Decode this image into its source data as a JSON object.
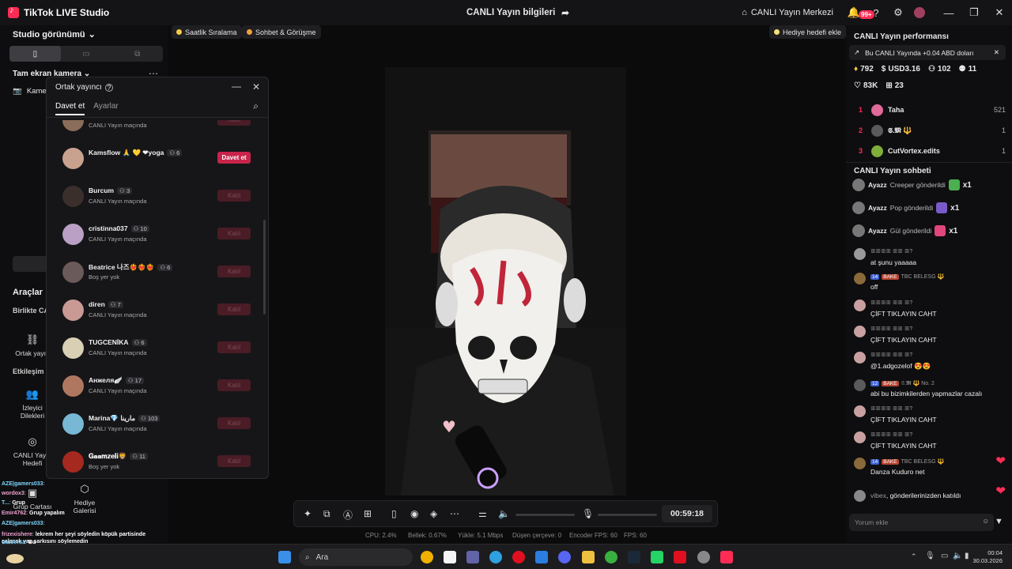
{
  "titlebar": {
    "app_name": "TikTok LIVE Studio",
    "center_title": "CANLI Yayın bilgileri",
    "center_btn": "CANLI Yayın Merkezi",
    "notif_badge": "99+"
  },
  "left": {
    "studio_view": "Studio görünümü",
    "fullscreen_camera": "Tam ekran kamera",
    "camera_label": "Kamera",
    "tools_title": "Araçlar",
    "together_label": "Birlikte CANLI",
    "cohost_label": "Ortak yayın",
    "interaction_label": "Etkileşim",
    "viewer_requests": "İzleyici Dilekleri",
    "live_goal": "CANLI Yayın Hedefi",
    "gift_card": "Grup Cartası",
    "gift_gallery": "Hediye Galerisi",
    "overlay_chat": [
      {
        "user": "AZE|gamers033",
        "text": ""
      },
      {
        "user": "wordox3",
        "text": ""
      },
      {
        "user": "T...",
        "text": "Grup"
      },
      {
        "user": "Emir4762",
        "text": "Grup yapalım"
      },
      {
        "user": "AZE|gamers033",
        "text": ""
      },
      {
        "user": "frizexishere",
        "text": "lekrem her şeyi söyledin köpük partisinde çalacak yaz şarkısını söylemedin"
      },
      {
        "user": "gaz8ersa",
        "text": "Bu"
      },
      {
        "user": "",
        "text": "Çok bulutlu"
      }
    ]
  },
  "pills": {
    "hourly_rank": "Saatlik Sıralama",
    "chat_meet": "Sohbet & Görüşme",
    "gift_goal": "Hediye hedefi ekle"
  },
  "dialog": {
    "title": "Ortak yayıncı",
    "tab_invite": "Davet et",
    "tab_settings": "Ayarlar",
    "rows": [
      {
        "name": "",
        "viewers": "",
        "status": "CANLI Yayın maçında",
        "button": "Katıl",
        "color": "#8a6d5a"
      },
      {
        "name": "Kamsflow 🙏 💛 ❤yoga",
        "viewers": "6",
        "status": "",
        "button": "Davet et",
        "color": "#c9a28f"
      },
      {
        "name": "Burcum",
        "viewers": "3",
        "status": "CANLI Yayın maçında",
        "button": "Katıl",
        "color": "#3b2f2c"
      },
      {
        "name": "cristinna037",
        "viewers": "10",
        "status": "CANLI Yayın maçında",
        "button": "Katıl",
        "color": "#b9a0c4"
      },
      {
        "name": "Beatrice 나즈❤️‍🔥❤️‍🔥❤️‍🔥",
        "viewers": "6",
        "status": "Boş yer yok",
        "button": "Katıl",
        "color": "#6a5a58"
      },
      {
        "name": "diren",
        "viewers": "7",
        "status": "CANLI Yayın maçında",
        "button": "Katıl",
        "color": "#c99a94"
      },
      {
        "name": "TUGCENİKA",
        "viewers": "6",
        "status": "CANLI Yayın maçında",
        "button": "Katıl",
        "color": "#d8cfb4"
      },
      {
        "name": "Анжеля🪽",
        "viewers": "17",
        "status": "CANLI Yayın maçında",
        "button": "Katıl",
        "color": "#b07760"
      },
      {
        "name": "Marina💎 مارينا",
        "viewers": "103",
        "status": "CANLI Yayın maçında",
        "button": "Katıl",
        "color": "#78b8d4"
      },
      {
        "name": "𝐆𝐚𝐚𝐦𝐳𝐞𝐥𝐢🦁",
        "viewers": "11",
        "status": "Boş yer yok",
        "button": "Katıl",
        "color": "#a5291f"
      }
    ]
  },
  "controls": {
    "timer": "00:59:18"
  },
  "stats": {
    "cpu": "CPU:  2.4%",
    "memory": "Bellek:  0.67%",
    "upload": "Yükle:  5.1 Mbps",
    "dropped": "Düşen çerçeve:  0",
    "encoder_fps": "Encoder FPS:  60",
    "fps": "FPS:  60"
  },
  "right": {
    "perf_title": "CANLI Yayın performansı",
    "banner": "Bu CANLI Yayında +0.04 ABD doları",
    "metrics": {
      "diamonds": "792",
      "usd": "USD3.16",
      "followers": "102",
      "new": "11",
      "likes": "83K",
      "gifts": "23"
    },
    "ranking": [
      {
        "n": "1",
        "name": "Taha",
        "value": "521",
        "color": "#e06a9a"
      },
      {
        "n": "2",
        "name": "𝕾.𝕸 🔱",
        "value": "1",
        "color": "#5a5a5a"
      },
      {
        "n": "3",
        "name": "CutVortex.edits",
        "value": "1",
        "color": "#7fae3a"
      }
    ],
    "chat_title": "CANLI Yayın sohbeti",
    "gifts": [
      {
        "user": "Ayazz",
        "gift": "Creeper gönderildi",
        "count": "x1",
        "color": "#4caf50"
      },
      {
        "user": "Ayazz",
        "gift": "Pop gönderildi",
        "count": "x1",
        "color": "#7a5ac8"
      },
      {
        "user": "Ayazz",
        "gift": "Gül gönderildi",
        "count": "x1",
        "color": "#e0457b"
      }
    ],
    "messages": [
      {
        "user": "ꕥꕥꕥꕥ ꕥꕥ ꕥ?",
        "level": "",
        "fan": "",
        "text": "at şunu yaaaaa",
        "color": "#999"
      },
      {
        "user": "TBC BELESG 🔱",
        "level": "14",
        "fan": "BAKE",
        "text": "off",
        "color": "#8a6a3a"
      },
      {
        "user": "ꕥꕥꕥꕥ ꕥꕥ ꕥ?",
        "level": "",
        "fan": "",
        "text": "ÇİFT TIKLAYIN CAHT",
        "color": "#c9a0a0"
      },
      {
        "user": "ꕥꕥꕥꕥ ꕥꕥ ꕥ?",
        "level": "",
        "fan": "",
        "text": "ÇİFT TIKLAYIN CAHT",
        "color": "#c9a0a0"
      },
      {
        "user": "ꕥꕥꕥꕥ ꕥꕥ ꕥ?",
        "level": "",
        "fan": "",
        "text": "@1.adgozelof 😍😍",
        "color": "#c9a0a0"
      },
      {
        "user": "𝕾.𝕸 🔱  No. 2",
        "level": "12",
        "fan": "BAKE",
        "text": "abi bu bizimkilerden yapmazlar cazalı",
        "color": "#5a5a5a"
      },
      {
        "user": "ꕥꕥꕥꕥ ꕥꕥ ꕥ?",
        "level": "",
        "fan": "",
        "text": "ÇİFT TIKLAYIN CAHT",
        "color": "#c9a0a0"
      },
      {
        "user": "ꕥꕥꕥꕥ ꕥꕥ ꕥ?",
        "level": "",
        "fan": "",
        "text": "ÇİFT TIKLAYIN CAHT",
        "color": "#c9a0a0"
      },
      {
        "user": "TBC BELESG 🔱",
        "level": "14",
        "fan": "BAKE",
        "text": "Danza Kuduro net",
        "color": "#8a6a3a"
      }
    ],
    "joined_user": "vibex",
    "joined_text": ", gönderilerinizden katıldı",
    "comment_placeholder": "Yorum ekle"
  },
  "taskbar": {
    "search_placeholder": "Ara",
    "time": "00:04",
    "date": "30.03.2026"
  }
}
